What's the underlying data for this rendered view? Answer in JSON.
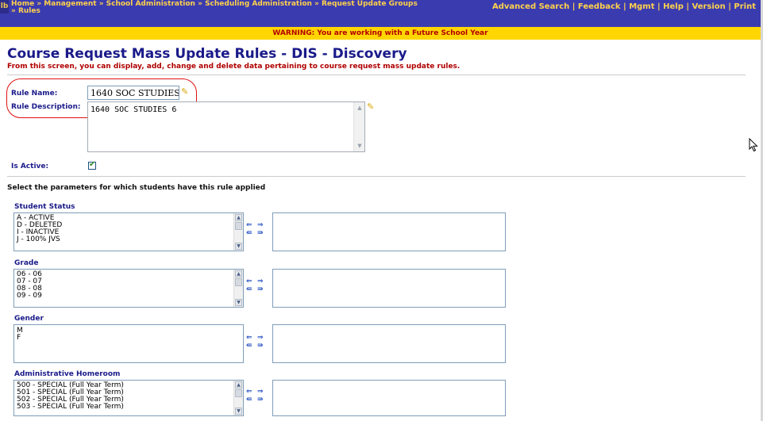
{
  "breadcrumb": {
    "items": [
      "Home",
      "Management",
      "School Administration",
      "Scheduling Administration",
      "Request Update Groups",
      "Rules"
    ],
    "separator": "»"
  },
  "top_links": [
    "Advanced Search",
    "Feedback",
    "Mgmt",
    "Help",
    "Version",
    "Print"
  ],
  "top_links_divider": "|",
  "warning": "WARNING: You are working with a Future School Year",
  "page": {
    "title": "Course Request Mass Update Rules - DIS - Discovery",
    "subtitle": "From this screen, you can display, add, change and delete data pertaining to course request mass update rules."
  },
  "form": {
    "rule_name_label": "Rule Name:",
    "rule_name_value": "1640 SOC STUDIES 6",
    "rule_description_label": "Rule Description:",
    "rule_description_value": "1640 SOC STUDIES 6",
    "is_active_label": "Is Active:",
    "is_active_checked": true
  },
  "parameters_heading": "Select the parameters for which students have this rule applied",
  "sections": [
    {
      "label": "Student Status",
      "options": [
        "A - ACTIVE",
        "D - DELETED",
        "I - INACTIVE",
        "J - 100% JVS"
      ],
      "has_scrollbar": true
    },
    {
      "label": "Grade",
      "options": [
        "06 - 06",
        "07 - 07",
        "08 - 08",
        "09 - 09"
      ],
      "has_scrollbar": true
    },
    {
      "label": "Gender",
      "options": [
        "M",
        "F"
      ],
      "has_scrollbar": false
    },
    {
      "label": "Administrative Homeroom",
      "options": [
        "500 - SPECIAL (Full Year Term)",
        "501 - SPECIAL (Full Year Term)",
        "502 - SPECIAL (Full Year Term)",
        "503 - SPECIAL (Full Year Term)"
      ],
      "has_scrollbar": true
    }
  ],
  "arrow_glyphs": {
    "add": "⇒",
    "remove": "⇐",
    "add_all": "⇛",
    "remove_all": "⇚"
  },
  "icons": {
    "edit": "pencil-icon",
    "check": "checkmark-icon",
    "cursor": "mouse-pointer-icon",
    "logo": "app-logo-icon"
  },
  "colors": {
    "nav_bg": "#3b3bb0",
    "nav_text": "#ffd24a",
    "warning_bg": "#ffd600",
    "warning_text": "#b30000",
    "title": "#1a1a8a",
    "subtitle": "#b00000",
    "highlight_oval": "#e01010"
  }
}
